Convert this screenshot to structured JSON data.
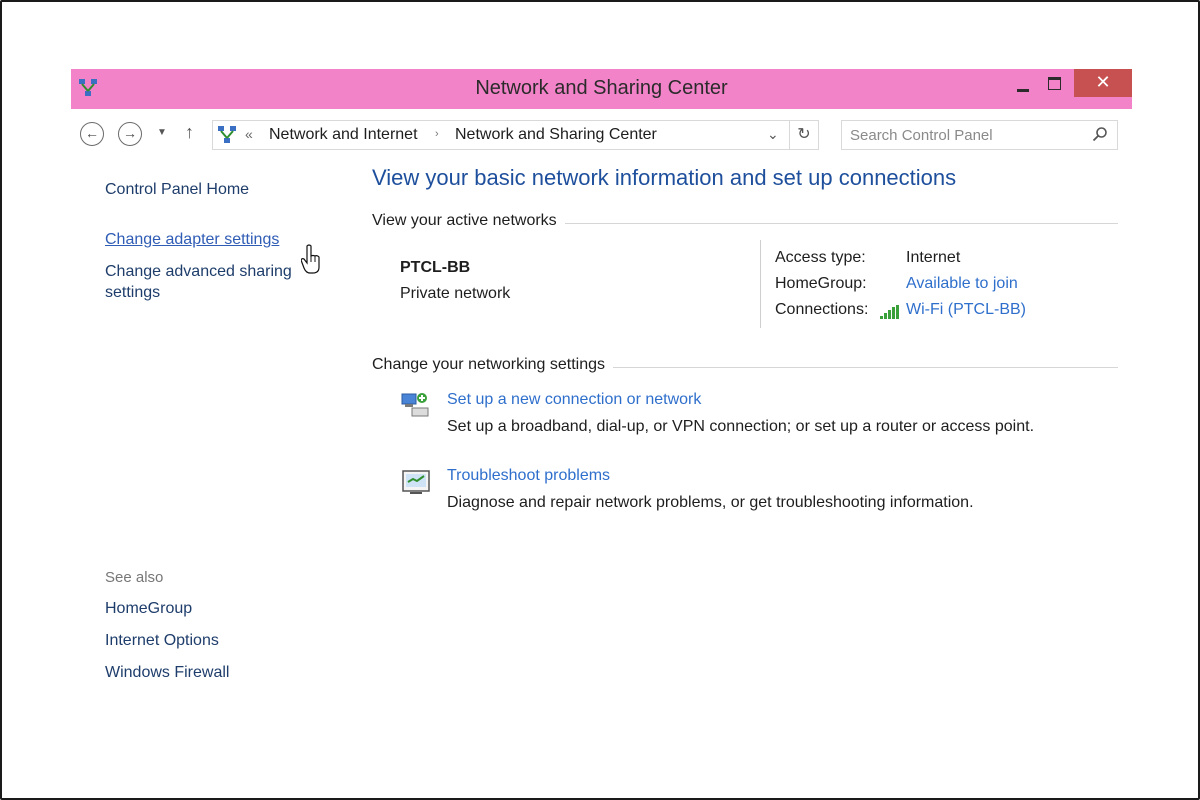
{
  "window": {
    "title": "Network and Sharing Center",
    "title_bar_color": "#f283c9",
    "controls": {
      "minimize_icon": "minimize-icon",
      "maximize_icon": "maximize-icon",
      "close_label": "✕"
    }
  },
  "address_bar": {
    "back_icon": "back-arrow-icon",
    "forward_icon": "forward-arrow-icon",
    "recent_icon": "chevron-down-icon",
    "up_icon": "up-arrow-icon",
    "location_icon": "network-icon",
    "overflow_label": "«",
    "breadcrumbs": [
      "Network and Internet",
      "Network and Sharing Center"
    ],
    "separator": "›",
    "dropdown_label": "⌄",
    "refresh_label": "↻",
    "search_placeholder": "Search Control Panel"
  },
  "left_pane": {
    "home": "Control Panel Home",
    "links": [
      "Change adapter settings",
      "Change advanced sharing settings"
    ],
    "see_also_title": "See also",
    "see_also": [
      "HomeGroup",
      "Internet Options",
      "Windows Firewall"
    ]
  },
  "main": {
    "heading": "View your basic network information and set up connections",
    "active_networks_title": "View your active networks",
    "network": {
      "name": "PTCL-BB",
      "type": "Private network",
      "access_type_label": "Access type:",
      "access_type_value": "Internet",
      "homegroup_label": "HomeGroup:",
      "homegroup_value": "Available to join",
      "connections_label": "Connections:",
      "connections_value": "Wi-Fi (PTCL-BB)"
    },
    "settings_title": "Change your networking settings",
    "tasks": [
      {
        "icon": "new-connection-icon",
        "link": "Set up a new connection or network",
        "description": "Set up a broadband, dial-up, or VPN connection; or set up a router or access point."
      },
      {
        "icon": "troubleshoot-icon",
        "link": "Troubleshoot problems",
        "description": "Diagnose and repair network problems, or get troubleshooting information."
      }
    ]
  },
  "colors": {
    "link": "#2f6fcc",
    "heading": "#1e4f9c",
    "close_button": "#c75050"
  }
}
